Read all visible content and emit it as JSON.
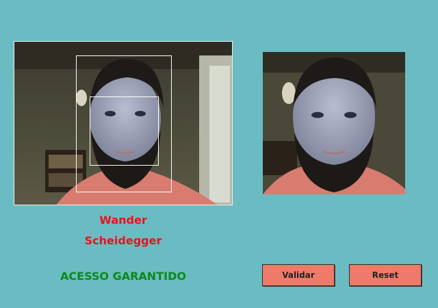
{
  "user": {
    "first_name": "Wander",
    "last_name": "Scheidegger"
  },
  "status": {
    "text": "ACESSO GARANTIDO",
    "color": "#0b8a19"
  },
  "buttons": {
    "validate_label": "Validar",
    "reset_label": "Reset"
  },
  "colors": {
    "background": "#6bbcc2",
    "button": "#ee7a69",
    "name": "#e8141a"
  }
}
